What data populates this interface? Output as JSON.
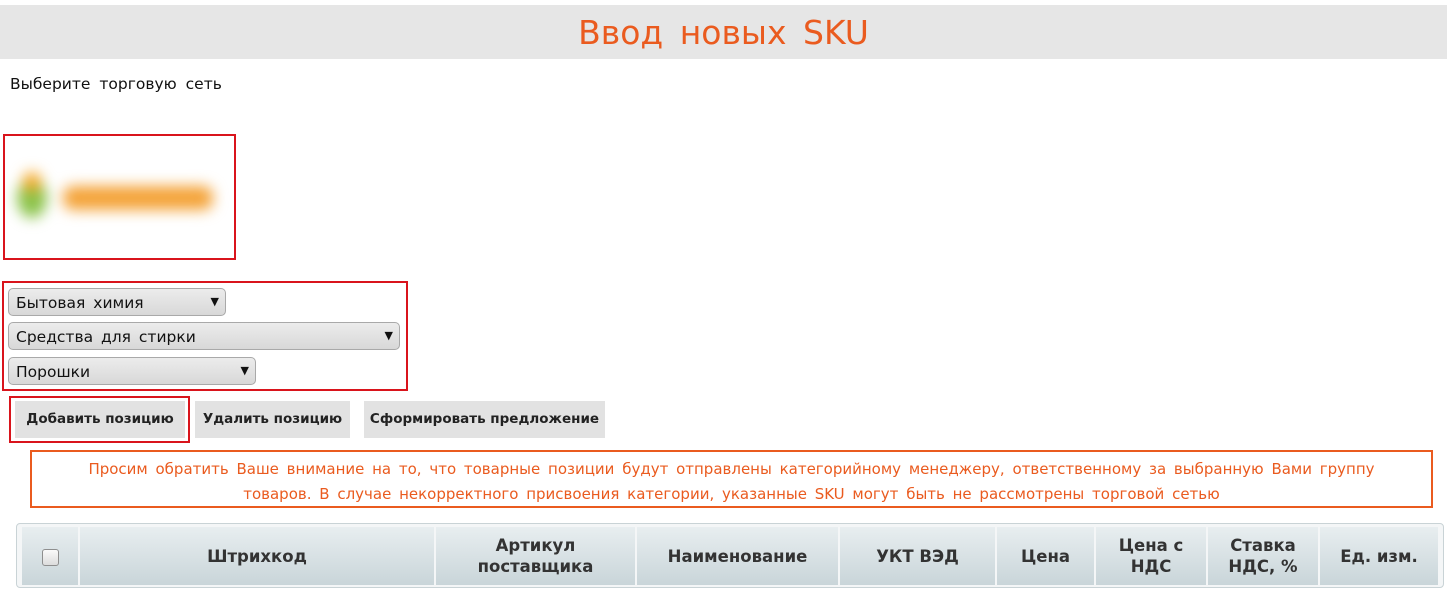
{
  "header": {
    "title": "Ввод новых SKU"
  },
  "subtitle": "Выберите торговую сеть",
  "logo": {
    "description": "blurred-retailer-logo"
  },
  "selects": [
    {
      "value": "Бытовая химия"
    },
    {
      "value": "Средства для стирки"
    },
    {
      "value": "Порошки"
    }
  ],
  "arrow_glyph": "▼",
  "buttons": {
    "add": "Добавить позицию",
    "delete": "Удалить позицию",
    "offer": "Сформировать предложение"
  },
  "notice": {
    "line1": "Просим обратить Ваше внимание на то, что товарные позиции будут отправлены категорийному менеджеру, ответственному за выбранную Вами группу",
    "line2": "товаров. В случае некорректного присвоения категории, указанные SKU могут быть не рассмотрены торговой сетью"
  },
  "table": {
    "columns": [
      {
        "line1": "Штрихкод",
        "line2": ""
      },
      {
        "line1": "Артикул",
        "line2": "поставщика"
      },
      {
        "line1": "Наименование",
        "line2": ""
      },
      {
        "line1": "УКТ ВЭД",
        "line2": ""
      },
      {
        "line1": "Цена",
        "line2": ""
      },
      {
        "line1": "Цена с",
        "line2": "НДС"
      },
      {
        "line1": "Ставка",
        "line2": "НДС, %"
      },
      {
        "line1": "Ед. изм.",
        "line2": ""
      }
    ]
  },
  "colors": {
    "accent": "#ea5b1f",
    "highlight_border": "#d9141c",
    "header_bar": "#e6e6e6"
  }
}
